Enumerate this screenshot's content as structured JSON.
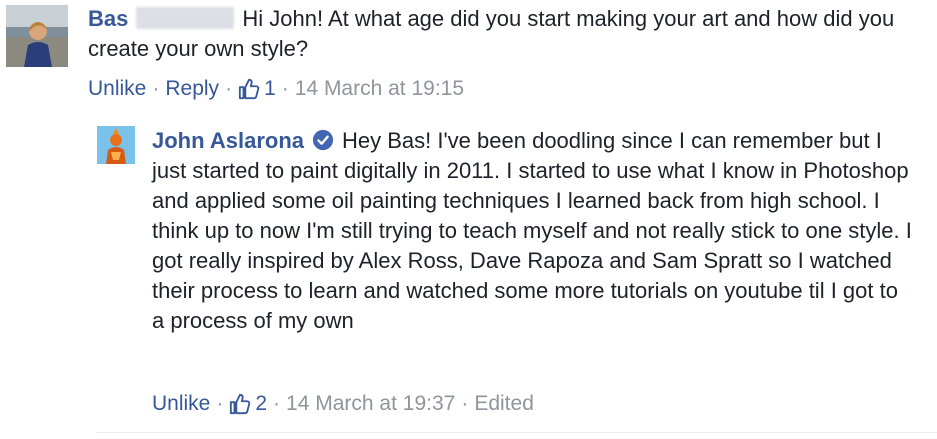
{
  "comment": {
    "author": "Bas",
    "text": "Hi John! At what age did you start making your art and how did you create your own style?",
    "actions": {
      "unlike": "Unlike",
      "reply": "Reply",
      "like_count": "1",
      "timestamp": "14 March at 19:15"
    }
  },
  "reply": {
    "author": "John Aslarona",
    "verified_icon": "verified-badge-icon",
    "text": "Hey Bas! I've been doodling since I can remember but I just started to paint digitally in 2011. I started to use what I know in Photoshop and applied some oil painting techniques I learned back from high school. I think up to now I'm still trying to teach myself and not really stick to one style. I got really inspired by Alex Ross, Dave Rapoza and Sam Spratt so I watched their process to learn and watched some more tutorials on youtube til I got to a process of my own",
    "actions": {
      "unlike": "Unlike",
      "like_count": "2",
      "timestamp": "14 March at 19:37",
      "edited": "Edited"
    }
  },
  "colors": {
    "link": "#365899",
    "meta": "#90949c",
    "text": "#1d2129",
    "verified": "#4267b2"
  }
}
